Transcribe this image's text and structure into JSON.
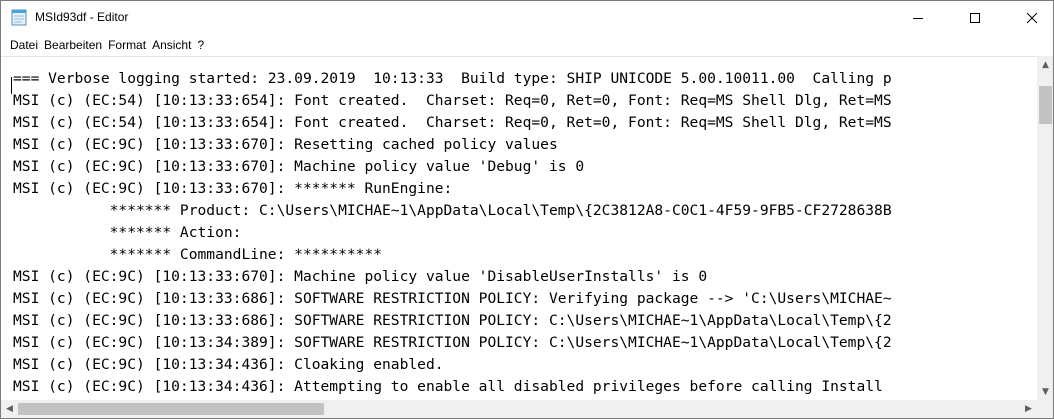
{
  "window": {
    "title": "MSId93df - Editor",
    "icon": "notepad-icon",
    "controls": {
      "minimize": "minimize-icon",
      "maximize": "maximize-icon",
      "close": "close-icon"
    }
  },
  "menu": {
    "items": [
      "Datei",
      "Bearbeiten",
      "Format",
      "Ansicht",
      "?"
    ]
  },
  "editor": {
    "lines": [
      "=== Verbose logging started: 23.09.2019  10:13:33  Build type: SHIP UNICODE 5.00.10011.00  Calling p",
      "MSI (c) (EC:54) [10:13:33:654]: Font created.  Charset: Req=0, Ret=0, Font: Req=MS Shell Dlg, Ret=MS",
      "MSI (c) (EC:54) [10:13:33:654]: Font created.  Charset: Req=0, Ret=0, Font: Req=MS Shell Dlg, Ret=MS",
      "MSI (c) (EC:9C) [10:13:33:670]: Resetting cached policy values",
      "MSI (c) (EC:9C) [10:13:33:670]: Machine policy value 'Debug' is 0",
      "MSI (c) (EC:9C) [10:13:33:670]: ******* RunEngine:",
      "           ******* Product: C:\\Users\\MICHAE~1\\AppData\\Local\\Temp\\{2C3812A8-C0C1-4F59-9FB5-CF2728638B",
      "           ******* Action:",
      "           ******* CommandLine: **********",
      "MSI (c) (EC:9C) [10:13:33:670]: Machine policy value 'DisableUserInstalls' is 0",
      "MSI (c) (EC:9C) [10:13:33:686]: SOFTWARE RESTRICTION POLICY: Verifying package --> 'C:\\Users\\MICHAE~",
      "MSI (c) (EC:9C) [10:13:33:686]: SOFTWARE RESTRICTION POLICY: C:\\Users\\MICHAE~1\\AppData\\Local\\Temp\\{2",
      "MSI (c) (EC:9C) [10:13:34:389]: SOFTWARE RESTRICTION POLICY: C:\\Users\\MICHAE~1\\AppData\\Local\\Temp\\{2",
      "MSI (c) (EC:9C) [10:13:34:436]: Cloaking enabled.",
      "MSI (c) (EC:9C) [10:13:34:436]: Attempting to enable all disabled privileges before calling Install"
    ]
  },
  "scrollbars": {
    "vertical": {
      "up_icon": "scroll-up-icon",
      "down_icon": "scroll-down-icon"
    },
    "horizontal": {
      "left_icon": "scroll-left-icon",
      "right_icon": "scroll-right-icon"
    }
  }
}
